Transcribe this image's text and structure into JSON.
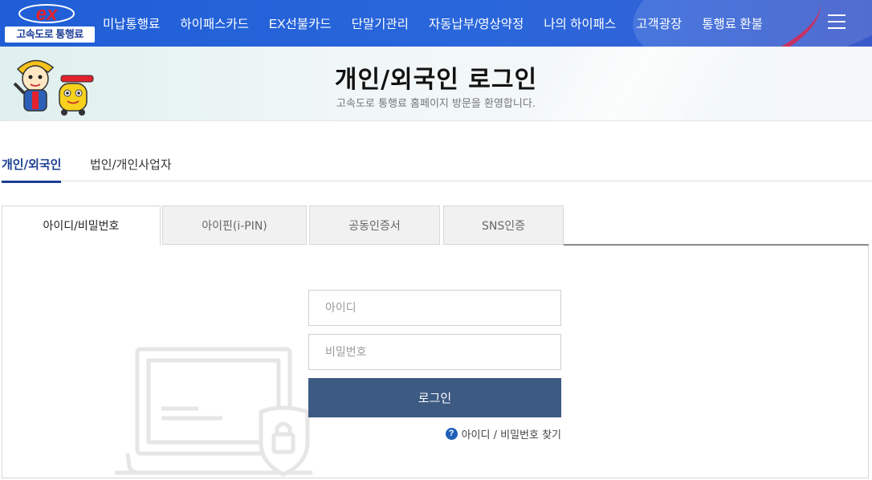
{
  "header": {
    "logo_text": "고속도로 통행료",
    "nav": [
      "미납통행료",
      "하이패스카드",
      "EX선불카드",
      "단말기관리",
      "자동납부/영상약정",
      "나의 하이패스",
      "고객광장",
      "통행료 환불"
    ]
  },
  "banner": {
    "title": "개인/외국인 로그인",
    "subtitle": "고속도로 통행료 홈페이지 방문을 환영합니다."
  },
  "user_tabs": [
    "개인/외국인",
    "법인/개인사업자"
  ],
  "method_tabs": [
    "아이디/비밀번호",
    "아이핀(i-PIN)",
    "공동인증서",
    "SNS인증"
  ],
  "form": {
    "id_placeholder": "아이디",
    "password_placeholder": "비밀번호",
    "login_label": "로그인",
    "find_label": "아이디 / 비밀번호 찾기",
    "help_glyph": "?"
  },
  "colors": {
    "header_blue": "#2a66db",
    "accent_navy": "#1a3f8f",
    "button": "#3d5a82"
  }
}
